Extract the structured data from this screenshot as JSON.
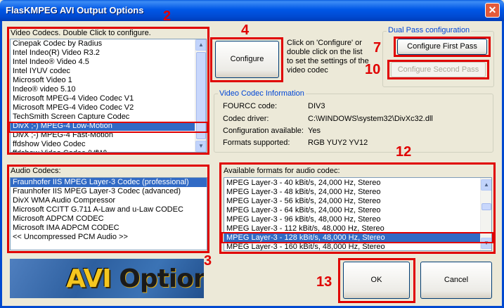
{
  "window": {
    "title": "FlasKMPEG AVI Output Options",
    "close_symbol": "✕"
  },
  "video": {
    "label": "Video Codecs. Double Click to configure.",
    "items": [
      "Cinepak Codec by Radius",
      "Intel Indeo(R) Video R3.2",
      "Intel Indeo® Video 4.5",
      "Intel IYUV codec",
      "Microsoft Video 1",
      "Indeo® video 5.10",
      "Microsoft MPEG-4 Video Codec V1",
      "Microsoft MPEG-4 Video Codec V2",
      "TechSmith Screen Capture Codec",
      "DivX ;-) MPEG-4 Low-Motion",
      "DivX ;-) MPEG-4 Fast-Motion",
      "ffdshow Video Codec",
      "ffdshow Video Codec (VfW)"
    ],
    "selected_index": 9
  },
  "configure": {
    "button": "Configure",
    "help": "Click on 'Configure' or double click on the list to set the settings of the video codec"
  },
  "dual_pass": {
    "title": "Dual Pass configuration",
    "first": "Configure First Pass",
    "second": "Configure Second Pass"
  },
  "codec_info": {
    "title": "Video Codec Information",
    "rows": [
      {
        "key": "FOURCC code:",
        "value": "DIV3"
      },
      {
        "key": "Codec driver:",
        "value": "C:\\WINDOWS\\system32\\DivXc32.dll"
      },
      {
        "key": "Configuration available:",
        "value": "Yes"
      },
      {
        "key": "Formats supported:",
        "value": "RGB YUY2 YV12"
      }
    ]
  },
  "audio": {
    "label": "Audio Codecs:",
    "items": [
      "Fraunhofer IIS MPEG Layer-3 Codec (professional)",
      "Fraunhofer IIS MPEG Layer-3 Codec (advanced)",
      "DivX WMA Audio Compressor",
      "Microsoft CCITT G.711 A-Law and u-Law CODEC",
      "Microsoft ADPCM CODEC",
      "Microsoft IMA ADPCM CODEC",
      "<< Uncompressed PCM Audio >>"
    ],
    "selected_index": 0
  },
  "formats": {
    "label": "Available formats for audio codec:",
    "items": [
      "MPEG Layer-3 - 40 kBit/s, 24,000 Hz, Stereo",
      "MPEG Layer-3 - 48 kBit/s, 24,000 Hz, Stereo",
      "MPEG Layer-3 - 56 kBit/s, 24,000 Hz, Stereo",
      "MPEG Layer-3 - 64 kBit/s, 24,000 Hz, Stereo",
      "MPEG Layer-3 - 96 kBit/s, 48,000 Hz, Stereo",
      "MPEG Layer-3 - 112 kBit/s, 48,000 Hz, Stereo",
      "MPEG Layer-3 - 128 kBit/s, 48,000 Hz, Stereo",
      "MPEG Layer-3 - 160 kBit/s, 48,000 Hz, Stereo"
    ],
    "selected_index": 6
  },
  "logo": {
    "part1": "AVI",
    "part2": "Options"
  },
  "buttons": {
    "ok": "OK",
    "cancel": "Cancel"
  },
  "annotations": {
    "n2": "2",
    "n3": "3",
    "n4": "4",
    "n7": "7",
    "n10": "10",
    "n12": "12",
    "n13": "13"
  },
  "colors": {
    "annotation_red": "#e00000",
    "selection_blue": "#316ac5",
    "title_blue": "#0049d0",
    "group_title": "#0046d5"
  },
  "icons": {
    "scroll_up": "▲",
    "scroll_down": "▼"
  }
}
